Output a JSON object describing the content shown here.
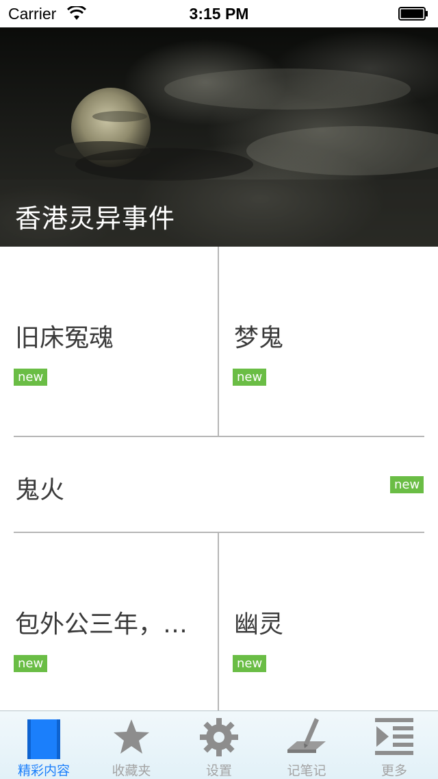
{
  "status_bar": {
    "carrier": "Carrier",
    "time": "3:15 PM"
  },
  "hero": {
    "title": "香港灵异事件"
  },
  "grid": {
    "items": [
      {
        "title": "旧床冤魂",
        "badge": "new"
      },
      {
        "title": "梦鬼",
        "badge": "new"
      },
      {
        "title": "鬼火",
        "badge": "new"
      },
      {
        "title": "包外公三年，…",
        "badge": "new"
      },
      {
        "title": "幽灵",
        "badge": "new"
      }
    ]
  },
  "tab_bar": {
    "tabs": [
      {
        "label": "精彩内容",
        "icon": "book-icon",
        "active": true
      },
      {
        "label": "收藏夹",
        "icon": "star-icon",
        "active": false
      },
      {
        "label": "设置",
        "icon": "gear-icon",
        "active": false
      },
      {
        "label": "记笔记",
        "icon": "pen-icon",
        "active": false
      },
      {
        "label": "更多",
        "icon": "list-icon",
        "active": false
      }
    ]
  },
  "colors": {
    "accent": "#1b7ffb",
    "badge": "#6abd45",
    "inactive": "#a3a3a3"
  }
}
